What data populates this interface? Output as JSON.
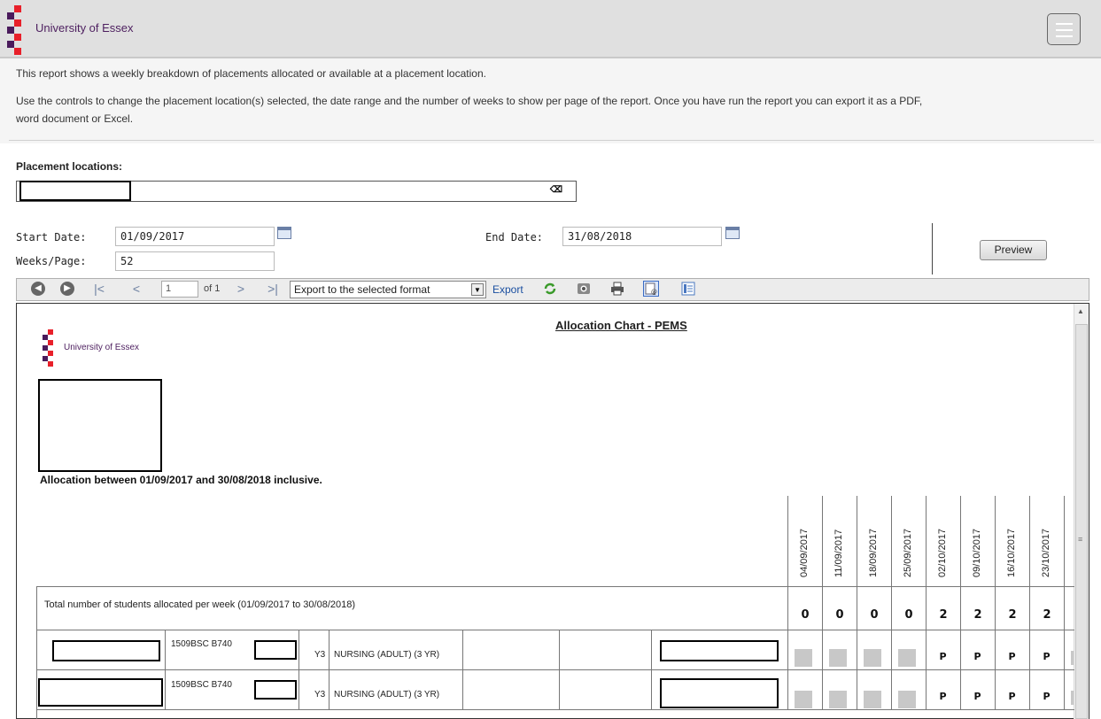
{
  "header": {
    "brand": "University of Essex",
    "brand_color": "#4d1f5f",
    "menu_icon": "hamburger-icon"
  },
  "intro": {
    "line1": "This report shows a weekly breakdown of placements allocated or available at a placement location.",
    "line2a": "Use the controls to change the placement location(s) selected, the date range and the number of weeks to show per page of the report. Once you have run the report you can export it as a PDF,",
    "line2b": "word document or Excel."
  },
  "filters": {
    "locations_label": "Placement locations:",
    "clear_icon": "clear-icon",
    "start_label": "Start Date:",
    "start_value": "01/09/2017",
    "end_label": "End Date:",
    "end_value": "31/08/2018",
    "weeks_label": "Weeks/Page:",
    "weeks_value": "52",
    "preview_label": "Preview"
  },
  "toolbar": {
    "page_value": "1",
    "of_text": "of 1",
    "export_format": "Export to the selected format",
    "export_label": "Export"
  },
  "report": {
    "title": "Allocation Chart - PEMS",
    "brand": "University of Essex",
    "allocation_text": "Allocation between 01/09/2017 and 30/08/2018 inclusive.",
    "weeks": [
      "04/09/2017",
      "11/09/2017",
      "18/09/2017",
      "25/09/2017",
      "02/10/2017",
      "09/10/2017",
      "16/10/2017",
      "23/10/2017"
    ],
    "total_label": "Total number of students allocated per week (01/09/2017 to 30/08/2018)",
    "totals": [
      "0",
      "0",
      "0",
      "0",
      "2",
      "2",
      "2",
      "2"
    ],
    "rows": [
      {
        "code": "1509BSC B740",
        "year": "Y3",
        "course": "NURSING (ADULT) (3 YR)",
        "marks": [
          "",
          "",
          "",
          "",
          "P",
          "P",
          "P",
          "P"
        ]
      },
      {
        "code": "1509BSC B740",
        "year": "Y3",
        "course": "NURSING (ADULT) (3 YR)",
        "marks": [
          "",
          "",
          "",
          "",
          "P",
          "P",
          "P",
          "P"
        ]
      }
    ]
  },
  "colors": {
    "logo_purple": "#4a1b5c",
    "logo_red": "#e8202a",
    "link_blue": "#1a4fa0",
    "unavailable_gray": "#c8c8c8"
  }
}
